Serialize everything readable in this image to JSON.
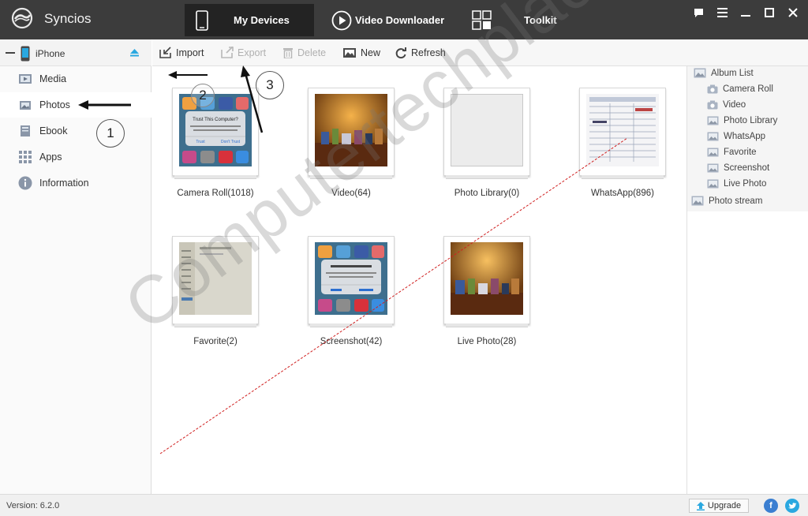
{
  "app": {
    "name": "Syncios"
  },
  "nav": {
    "tabs": [
      {
        "label": "My Devices",
        "active": true
      },
      {
        "label": "Video Downloader",
        "active": false
      },
      {
        "label": "Toolkit",
        "active": false
      }
    ]
  },
  "device": {
    "name": "iPhone"
  },
  "sidebar": {
    "items": [
      {
        "label": "Media",
        "icon": "media-icon",
        "selected": false
      },
      {
        "label": "Photos",
        "icon": "photos-icon",
        "selected": true
      },
      {
        "label": "Ebook",
        "icon": "ebook-icon",
        "selected": false
      },
      {
        "label": "Apps",
        "icon": "apps-grid-icon",
        "selected": false
      },
      {
        "label": "Information",
        "icon": "info-icon",
        "selected": false
      }
    ]
  },
  "toolbar": {
    "import": "Import",
    "export": "Export",
    "delete": "Delete",
    "new": "New",
    "refresh": "Refresh"
  },
  "albums": [
    {
      "label": "Camera Roll(1018)",
      "thumb": "iphone-trust-dialog"
    },
    {
      "label": "Video(64)",
      "thumb": "shelf-photo"
    },
    {
      "label": "Photo Library(0)",
      "thumb": "empty"
    },
    {
      "label": "WhatsApp(896)",
      "thumb": "document-form"
    },
    {
      "label": "Favorite(2)",
      "thumb": "screen-photo"
    },
    {
      "label": "Screenshot(42)",
      "thumb": "iphone-trust-dialog"
    },
    {
      "label": "Live Photo(28)",
      "thumb": "shelf-photo"
    }
  ],
  "thumbtext": {
    "trust_title": "Trust This Computer?",
    "trust_body": "Your settings and data will be accessible from this computer when connected.",
    "trust_btn": "Trust",
    "dont_trust_btn": "Don't Trust"
  },
  "rightpanel": {
    "header": "Album List",
    "items": [
      "Camera Roll",
      "Video",
      "Photo Library",
      "WhatsApp",
      "Favorite",
      "Screenshot",
      "Live Photo"
    ],
    "stream": "Photo stream"
  },
  "status": {
    "version": "Version: 6.2.0",
    "upgrade": "Upgrade"
  },
  "annotations": {
    "n1": "1",
    "n2": "2",
    "n3": "3",
    "watermark": "Computertechplace"
  },
  "colors": {
    "titlebar": "#3c3c3c",
    "active_tab": "#232323",
    "accent": "#2aa8e0",
    "facebook": "#3b7fd1",
    "twitter": "#2aa8e0"
  }
}
